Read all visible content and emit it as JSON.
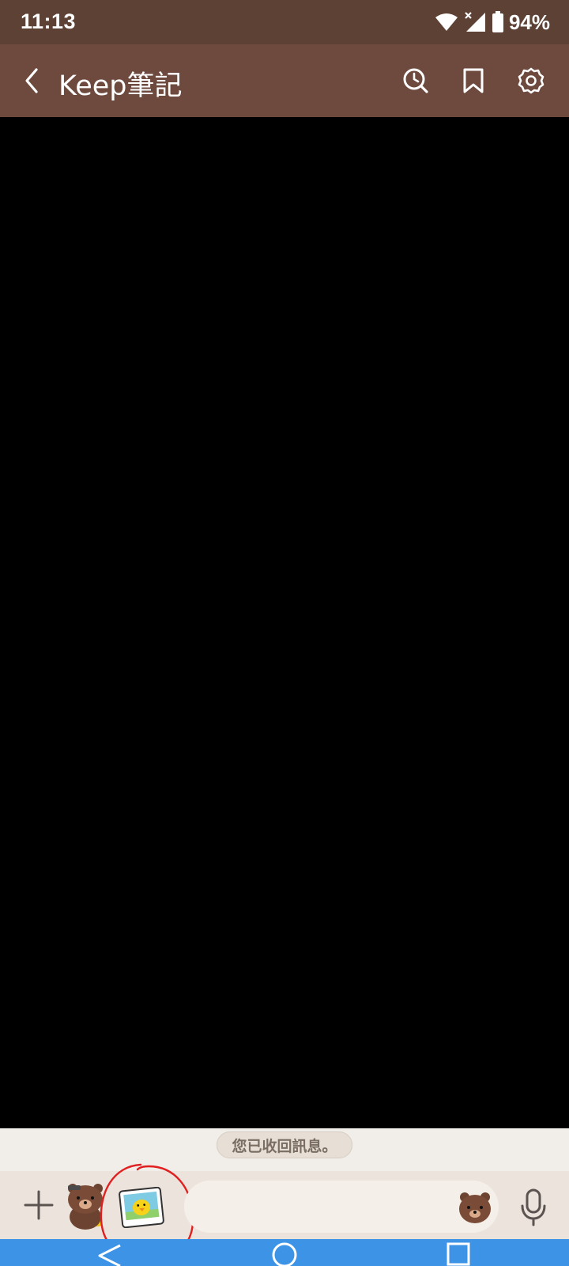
{
  "status_bar": {
    "time": "11:13",
    "battery": "94%",
    "icons": [
      "wifi-icon",
      "signal-icon",
      "battery-icon"
    ]
  },
  "app_bar": {
    "title": "Keep筆記",
    "icons": [
      "back-icon",
      "search-history-icon",
      "bookmark-icon",
      "settings-icon"
    ],
    "color": "#6d4a3d"
  },
  "notice": {
    "text": "您已收回訊息。"
  },
  "input_bar": {
    "message_placeholder": "",
    "icons": [
      "plus-icon",
      "brown-bear-sticker-icon",
      "photo-sticker-icon",
      "bear-emoji-icon",
      "microphone-icon"
    ]
  },
  "nav_bar": {
    "icons": [
      "nav-back-icon",
      "nav-home-icon",
      "nav-recents-icon"
    ],
    "color": "#3d93e6"
  }
}
